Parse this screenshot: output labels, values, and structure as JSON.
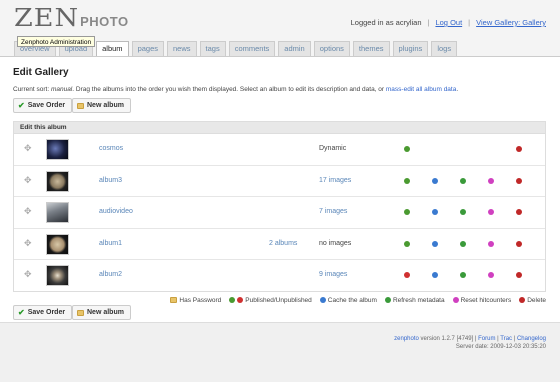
{
  "header": {
    "logo_zen": "ZEN",
    "logo_photo": "PHOTO",
    "logged_in": "Logged in as acrylian",
    "logout": "Log Out",
    "view_gallery": "View Gallery: Gallery",
    "tooltip": "Zenphoto Administration"
  },
  "tabs": [
    "overview",
    "upload",
    "album",
    "pages",
    "news",
    "tags",
    "comments",
    "admin",
    "options",
    "themes",
    "plugins",
    "logs"
  ],
  "active_tab": "album",
  "page": {
    "title": "Edit Gallery",
    "subtext_pre": "Current sort: ",
    "subtext_sort": "manual",
    "subtext_mid": ". Drag the albums into the order you wish them displayed. Select an album to edit its description and data, or ",
    "subtext_link": "mass-edit all album data",
    "subtext_end": ".",
    "save_order": "Save Order",
    "new_album": "New album"
  },
  "panel": {
    "header": "Edit this album",
    "albums": [
      {
        "name": "cosmos",
        "subalbums": "",
        "count": "Dynamic",
        "count_link": false
      },
      {
        "name": "album3",
        "subalbums": "",
        "count": "17 images",
        "count_link": true
      },
      {
        "name": "audiovideo",
        "subalbums": "",
        "count": "7 images",
        "count_link": true
      },
      {
        "name": "album1",
        "subalbums": "2 albums",
        "count": "no images",
        "count_link": false
      },
      {
        "name": "album2",
        "subalbums": "",
        "count": "9 images",
        "count_link": true
      }
    ]
  },
  "legend": {
    "has_password": "Has Password",
    "published": "Published/Unpublished",
    "cache": "Cache the album",
    "refresh": "Refresh metadata",
    "reset": "Reset hitcounters",
    "delete": "Delete"
  },
  "footer": {
    "brand": "zenphoto",
    "version": " version 1.2.7 [4749] | ",
    "forum": "Forum",
    "sep1": " | ",
    "trac": "Trac",
    "sep2": " | ",
    "changelog": "Changelog",
    "server_date": "Server date: 2009-12-03 20:35:20"
  },
  "colors": {
    "link": "#5a86b8",
    "published": "#4a9a30",
    "unpublished": "#d03030",
    "cache": "#3a7ad0",
    "refresh": "#3a9a3a",
    "reset": "#d040c0",
    "delete": "#c02828"
  }
}
